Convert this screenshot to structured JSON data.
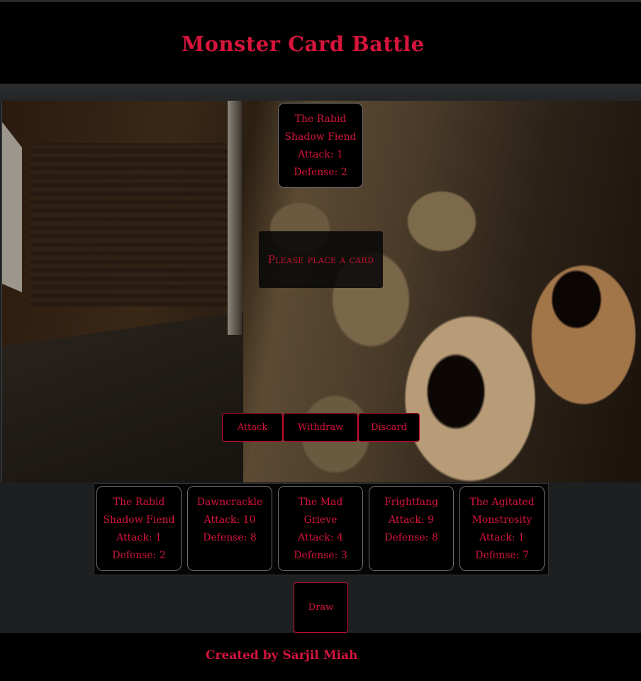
{
  "header": {
    "title": "Monster Card Battle"
  },
  "board": {
    "enemy_card": {
      "name_line1": "The Rabid",
      "name_line2": "Shadow Fiend",
      "attack": "Attack: 1",
      "defense": "Defense: 2"
    },
    "prompt": "Please place a card",
    "actions": {
      "attack": "Attack",
      "withdraw": "Withdraw",
      "discard": "Discard"
    }
  },
  "hand": [
    {
      "lines": [
        "The Rabid",
        "Shadow Fiend",
        "Attack: 1",
        "Defense: 2"
      ]
    },
    {
      "lines": [
        "Dawncrackle",
        "Attack: 10",
        "Defense: 8"
      ]
    },
    {
      "lines": [
        "The Mad",
        "Grieve",
        "Attack: 4",
        "Defense: 3"
      ]
    },
    {
      "lines": [
        "Frightfang",
        "Attack: 9",
        "Defense: 8"
      ]
    },
    {
      "lines": [
        "The Agitated",
        "Monstrosity",
        "Attack: 1",
        "Defense: 7"
      ]
    }
  ],
  "draw_label": "Draw",
  "footer": {
    "credit": "Created by Sarjil Miah"
  },
  "colors": {
    "accent": "#d6143c",
    "background": "#000000"
  }
}
